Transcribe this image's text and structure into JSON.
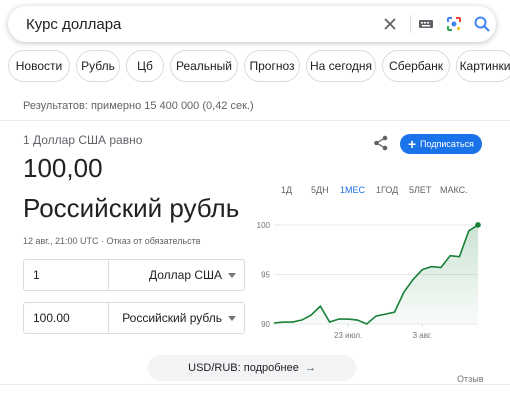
{
  "search": {
    "query": "Курс доллара",
    "icons": [
      "close-icon",
      "keyboard-icon",
      "lens-icon",
      "search-icon"
    ]
  },
  "chips": [
    "Новости",
    "Рубль",
    "Цб",
    "Реальный",
    "Прогноз",
    "На сегодня",
    "Сбербанк",
    "Картинки"
  ],
  "results_count": "Результатов: примерно 15 400 000 (0,42 сек.)",
  "converter": {
    "pre_title": "1 Доллар США равно",
    "amount": "100,00",
    "currency_name": "Российский рубль",
    "timestamp": "12 авг., 21:00 UTC · Отказ от обязательств",
    "subscribe_label": "Подписаться",
    "from": {
      "value": "1",
      "currency": "Доллар США"
    },
    "to": {
      "value": "100.00",
      "currency": "Российский рубль"
    }
  },
  "ranges": [
    {
      "label": "1Д",
      "active": false
    },
    {
      "label": "5ДН",
      "active": false
    },
    {
      "label": "1МЕС",
      "active": true
    },
    {
      "label": "1ГОД",
      "active": false
    },
    {
      "label": "5ЛЕТ",
      "active": false
    },
    {
      "label": "МАКС.",
      "active": false
    }
  ],
  "chart_data": {
    "type": "area",
    "color": "#188038",
    "y_ticks": [
      "100",
      "95",
      "90"
    ],
    "ylim": [
      90,
      100.5
    ],
    "x_ticks": [
      {
        "label": "23 июл.",
        "index": 8
      },
      {
        "label": "3 авг.",
        "index": 16
      }
    ],
    "values": [
      90.1,
      90.2,
      90.2,
      90.4,
      90.9,
      91.8,
      90.2,
      90.5,
      90.5,
      90.4,
      90.0,
      90.8,
      91.0,
      91.2,
      93.2,
      94.5,
      95.5,
      95.8,
      95.7,
      96.9,
      96.8,
      99.4,
      100.0
    ]
  },
  "more_label": "USD/RUB: подробнее",
  "feedback_label": "Отзыв"
}
